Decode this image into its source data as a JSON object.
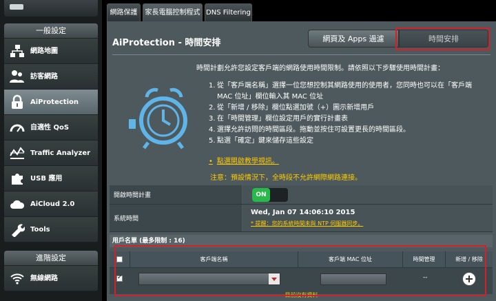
{
  "sidebar": {
    "top_text": "",
    "general_header": "一般設定",
    "general_items": [
      {
        "label": "網路地圖",
        "icon": "network-map-icon"
      },
      {
        "label": "訪客網路",
        "icon": "guest-network-icon"
      },
      {
        "label": "AiProtection",
        "icon": "lock-icon"
      },
      {
        "label": "自適性 QoS",
        "icon": "gauge-icon"
      },
      {
        "label": "Traffic Analyzer",
        "icon": "traffic-analyzer-icon"
      },
      {
        "label": "USB 應用",
        "icon": "puzzle-icon"
      },
      {
        "label": "AiCloud 2.0",
        "icon": "cloud-icon"
      },
      {
        "label": "Tools",
        "icon": "wrench-icon"
      }
    ],
    "advanced_header": "進階設定",
    "advanced_items": [
      {
        "label": "無線網路",
        "icon": "wifi-icon"
      }
    ]
  },
  "tabs": [
    "網路保護",
    "家長電腦控制程式",
    "DNS Filtering"
  ],
  "main": {
    "title": "AiProtection - 時間安排",
    "switch_left": "網頁及 Apps 過濾",
    "switch_right": "時間安排",
    "intro": "時間計劃允許您設定客戶端的網路使用時間限制。請依照以下步驟使用時間計畫：",
    "steps": [
      {
        "n": "1.",
        "text": "從「客戶端名稱」選擇一位您想控制其網路使用的使用者，您同時也可以在「客戶端 MAC 位址」欄位輸入其 MAC 位址"
      },
      {
        "n": "2.",
        "text": "從「新增 / 移除」欄位點選加號（+）圖示新增用戶"
      },
      {
        "n": "3.",
        "text": "在「時間管理」欄位設定用戶的實行計畫表"
      },
      {
        "n": "4.",
        "text": "選擇允許訪問的時間區段。拖動並按住可設置更長的時間區段。"
      },
      {
        "n": "5.",
        "text": "點選「確定」鍵來儲存這些設定"
      }
    ],
    "tutorial_link": "點選開啟教學視訊。",
    "note": "注意：預設情況下，全時段不允許網際網路連接。"
  },
  "settings": {
    "enable_label": "開啟時間計畫",
    "toggle_on": "ON",
    "system_time_label": "系統時間",
    "system_time_value": "Wed, Jan 07 14:06:10 2015",
    "ntp_link": "* 提醒：您的系統時間未與 NTP 伺服器同步。"
  },
  "client_list": {
    "header": "用戶名單 (最多限制 : 16)",
    "columns": [
      "客戶端名稱",
      "客戶端 MAC 位址",
      "時間管理",
      "新增 / 移除"
    ],
    "row_time_mgmt": "--",
    "no_data": "目前沒有資料"
  },
  "colors": {
    "highlight_red": "#d3212b",
    "toggle_green": "#28b94a",
    "note_yellow": "#ffcc00"
  }
}
